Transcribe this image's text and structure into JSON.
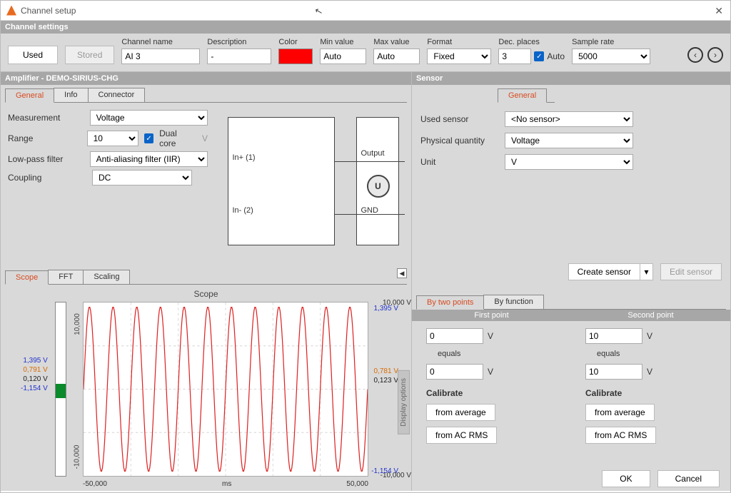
{
  "window": {
    "title": "Channel setup"
  },
  "channel_settings": {
    "header": "Channel settings",
    "used_btn": "Used",
    "stored_btn": "Stored",
    "name_lbl": "Channel name",
    "name_val": "AI 3",
    "desc_lbl": "Description",
    "desc_val": "-",
    "color_lbl": "Color",
    "color_val": "#ff0000",
    "min_lbl": "Min value",
    "min_val": "Auto",
    "max_lbl": "Max value",
    "max_val": "Auto",
    "format_lbl": "Format",
    "format_val": "Fixed",
    "dec_lbl": "Dec. places",
    "dec_val": "3",
    "dec_auto": "Auto",
    "rate_lbl": "Sample rate",
    "rate_val": "5000"
  },
  "amplifier": {
    "header": "Amplifier - DEMO-SIRIUS-CHG",
    "tabs": {
      "general": "General",
      "info": "Info",
      "connector": "Connector"
    },
    "measurement_lbl": "Measurement",
    "measurement_val": "Voltage",
    "range_lbl": "Range",
    "range_val": "10",
    "dualcore_lbl": "Dual core",
    "unit_sfx": "V",
    "lpf_lbl": "Low-pass filter",
    "lpf_val": "Anti-aliasing filter (IIR)",
    "coupling_lbl": "Coupling",
    "coupling_val": "DC",
    "pins": {
      "inp": "In+ (1)",
      "inn": "In- (2)",
      "out": "Output",
      "gnd": "GND",
      "u": "U"
    }
  },
  "scope": {
    "tabs": {
      "scope": "Scope",
      "fft": "FFT",
      "scaling": "Scaling"
    },
    "title": "Scope",
    "y_top": "10,000 V",
    "y_bot": "-10,000 V",
    "rot_top": "10,000",
    "rot_bot": "-10,000",
    "x_left": "-50,000",
    "x_mid": "ms",
    "x_right": "50,000",
    "disp_opt": "Display options",
    "sig_labels_left": [
      "1,395 V",
      "0,791 V",
      "0,120 V",
      "-1,154 V"
    ],
    "sig_colors_left": [
      "#2233cc",
      "#d86b00",
      "#222",
      "#2233cc"
    ],
    "sig_labels_right_top": "1,395 V",
    "sig_labels_right_mid1": "0,781 V",
    "sig_labels_right_mid2": "0,123 V",
    "sig_labels_right_bot": "-1,154 V"
  },
  "sensor": {
    "header": "Sensor",
    "tab_general": "General",
    "used_lbl": "Used sensor",
    "used_val": "<No sensor>",
    "qty_lbl": "Physical quantity",
    "qty_val": "Voltage",
    "unit_lbl": "Unit",
    "unit_val": "V",
    "create_btn": "Create sensor",
    "edit_btn": "Edit sensor"
  },
  "calibration": {
    "tabs": {
      "two": "By two points",
      "func": "By function"
    },
    "first_hdr": "First point",
    "second_hdr": "Second point",
    "unit": "V",
    "equals": "equals",
    "p1_in": "0",
    "p1_out": "0",
    "p2_in": "10",
    "p2_out": "10",
    "calibrate_lbl": "Calibrate",
    "from_avg": "from average",
    "from_rms": "from AC RMS"
  },
  "footer": {
    "ok": "OK",
    "cancel": "Cancel"
  },
  "chart_data": {
    "type": "line",
    "title": "Scope",
    "xlabel": "ms",
    "ylabel": "V",
    "xlim": [
      -50000,
      50000
    ],
    "ylim": [
      -10000,
      10000
    ],
    "series": [
      {
        "name": "AI 3",
        "color": "#d22",
        "waveform": "sine",
        "amplitude": 10000,
        "cycles": 12,
        "x_range": [
          -50000,
          50000
        ]
      }
    ],
    "markers": {
      "left": [
        {
          "label": "1,395 V",
          "value": 1395,
          "color": "#2233cc"
        },
        {
          "label": "0,791 V",
          "value": 791,
          "color": "#d86b00"
        },
        {
          "label": "0,120 V",
          "value": 120,
          "color": "#222"
        },
        {
          "label": "-1,154 V",
          "value": -1154,
          "color": "#2233cc"
        }
      ],
      "right": [
        {
          "label": "1,395 V",
          "value": 1395,
          "color": "#2233cc"
        },
        {
          "label": "0,781 V",
          "value": 781,
          "color": "#d86b00"
        },
        {
          "label": "0,123 V",
          "value": 123,
          "color": "#222"
        },
        {
          "label": "-1,154 V",
          "value": -1154,
          "color": "#2233cc"
        }
      ]
    }
  }
}
